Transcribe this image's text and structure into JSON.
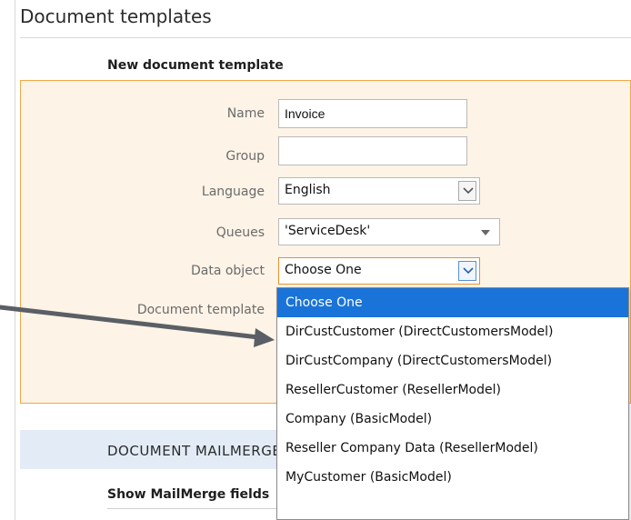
{
  "page": {
    "title": "Document templates",
    "section_heading": "New document template"
  },
  "form": {
    "name": {
      "label": "Name",
      "value": "Invoice"
    },
    "group": {
      "label": "Group",
      "value": ""
    },
    "language": {
      "label": "Language",
      "value": "English"
    },
    "queues": {
      "label": "Queues",
      "value": "'ServiceDesk'"
    },
    "data_object": {
      "label": "Data object",
      "value": "Choose One"
    },
    "document_template": {
      "label": "Document template"
    }
  },
  "dropdown": {
    "options": [
      "Choose One",
      "DirCustCustomer (DirectCustomersModel)",
      "DirCustCompany (DirectCustomersModel)",
      "ResellerCustomer (ResellerModel)",
      "Company (BasicModel)",
      "Reseller Company Data (ResellerModel)",
      "MyCustomer (BasicModel)"
    ],
    "selected_index": 0
  },
  "mailmerge": {
    "section_label": "DOCUMENT MAILMERGE",
    "show_fields_label": "Show MailMerge fields"
  },
  "colors": {
    "panel_bg": "#fdf3e7",
    "panel_border": "#f0a848",
    "selected_option": "#1a73d9",
    "mailmerge_bar": "#e3ecf6",
    "annotation_arrow": "#5a5f66"
  },
  "icons": {
    "select_button": "chevron-down-icon",
    "queues_caret": "caret-down-icon",
    "annotation": "arrow-annotation"
  }
}
